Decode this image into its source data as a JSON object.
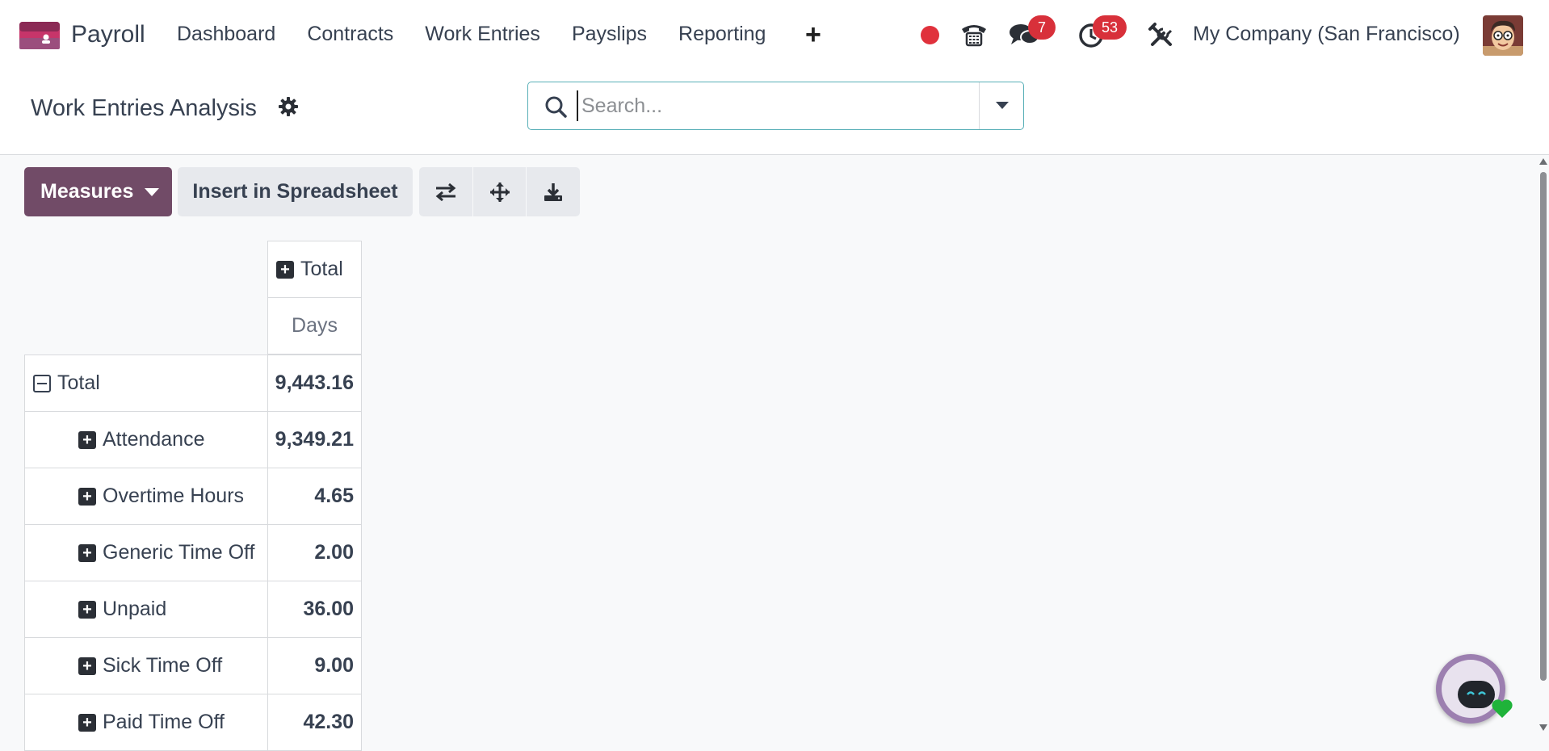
{
  "navbar": {
    "app_name": "Payroll",
    "menu": [
      "Dashboard",
      "Contracts",
      "Work Entries",
      "Payslips",
      "Reporting"
    ],
    "plus": "+",
    "chat_count": "7",
    "activity_count": "53",
    "company": "My Company (San Francisco)"
  },
  "control_panel": {
    "title": "Work Entries Analysis",
    "search_placeholder": "Search..."
  },
  "toolbar": {
    "measures_label": "Measures",
    "spreadsheet_label": "Insert in Spreadsheet"
  },
  "pivot": {
    "column_header": "Total",
    "measure": "Days",
    "total_row": {
      "label": "Total",
      "value": "9,443.16"
    },
    "rows": [
      {
        "label": "Attendance",
        "value": "9,349.21"
      },
      {
        "label": "Overtime Hours",
        "value": "4.65"
      },
      {
        "label": "Generic Time Off",
        "value": "2.00"
      },
      {
        "label": "Unpaid",
        "value": "36.00"
      },
      {
        "label": "Sick Time Off",
        "value": "9.00"
      },
      {
        "label": "Paid Time Off",
        "value": "42.30"
      }
    ]
  },
  "colors": {
    "brand": "#714b67",
    "badge": "#d8303a",
    "record": "#e0313c",
    "search_border": "#5ab0b8"
  },
  "icons": [
    "payroll-logo",
    "phone-icon",
    "chat-icon",
    "clock-icon",
    "tools-icon",
    "gear-icon",
    "search-icon",
    "caret-down-icon",
    "swap-icon",
    "move-icon",
    "download-icon",
    "plus-box-icon",
    "minus-box-icon",
    "heart-icon"
  ]
}
